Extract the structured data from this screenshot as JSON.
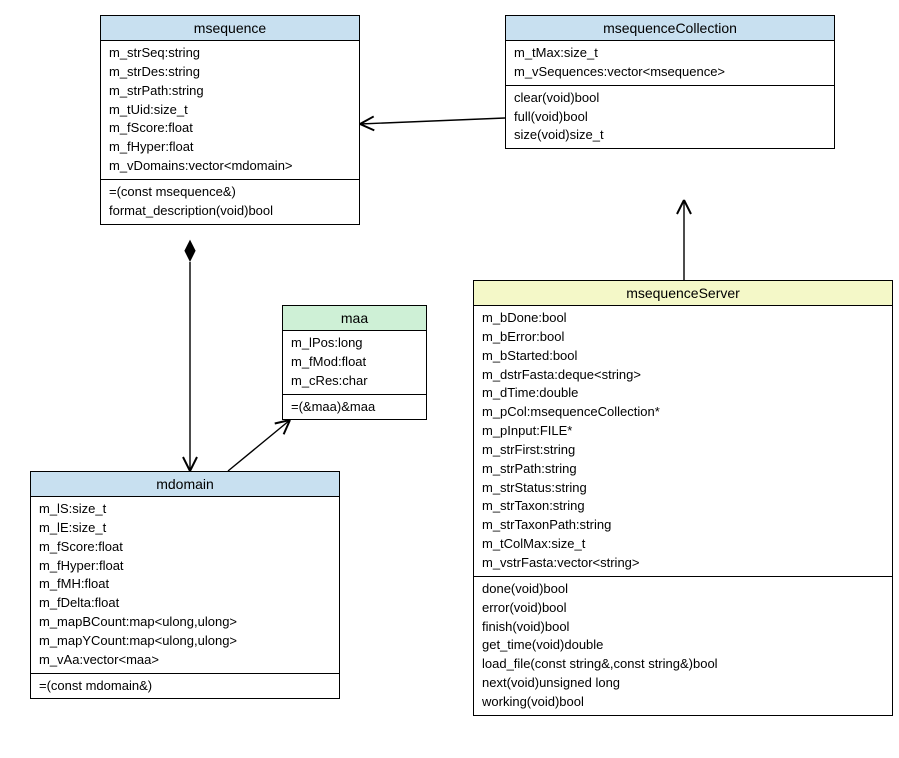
{
  "classes": {
    "msequence": {
      "name": "msequence",
      "attrs": [
        "m_strSeq:string",
        "m_strDes:string",
        "m_strPath:string",
        "m_tUid:size_t",
        "m_fScore:float",
        "m_fHyper:float",
        "m_vDomains:vector<mdomain>"
      ],
      "methods": [
        "=(const msequence&)",
        "format_description(void)bool"
      ]
    },
    "msequenceCollection": {
      "name": "msequenceCollection",
      "attrs": [
        "m_tMax:size_t",
        "m_vSequences:vector<msequence>"
      ],
      "methods": [
        "clear(void)bool",
        "full(void)bool",
        "size(void)size_t"
      ]
    },
    "maa": {
      "name": "maa",
      "attrs": [
        "m_lPos:long",
        "m_fMod:float",
        "m_cRes:char"
      ],
      "methods": [
        "=(&maa)&maa"
      ]
    },
    "mdomain": {
      "name": "mdomain",
      "attrs": [
        "m_lS:size_t",
        "m_lE:size_t",
        "m_fScore:float",
        "m_fHyper:float",
        "m_fMH:float",
        "m_fDelta:float",
        "m_mapBCount:map<ulong,ulong>",
        "m_mapYCount:map<ulong,ulong>",
        "m_vAa:vector<maa>"
      ],
      "methods": [
        "=(const mdomain&)"
      ]
    },
    "msequenceServer": {
      "name": "msequenceServer",
      "attrs": [
        "m_bDone:bool",
        "m_bError:bool",
        "m_bStarted:bool",
        "m_dstrFasta:deque<string>",
        "m_dTime:double",
        "m_pCol:msequenceCollection*",
        "m_pInput:FILE*",
        "m_strFirst:string",
        "m_strPath:string",
        "m_strStatus:string",
        "m_strTaxon:string",
        "m_strTaxonPath:string",
        "m_tColMax:size_t",
        "m_vstrFasta:vector<string>"
      ],
      "methods": [
        "done(void)bool",
        "error(void)bool",
        "finish(void)bool",
        "get_time(void)double",
        "load_file(const string&,const string&)bool",
        "next(void)unsigned long",
        "working(void)bool"
      ]
    }
  }
}
